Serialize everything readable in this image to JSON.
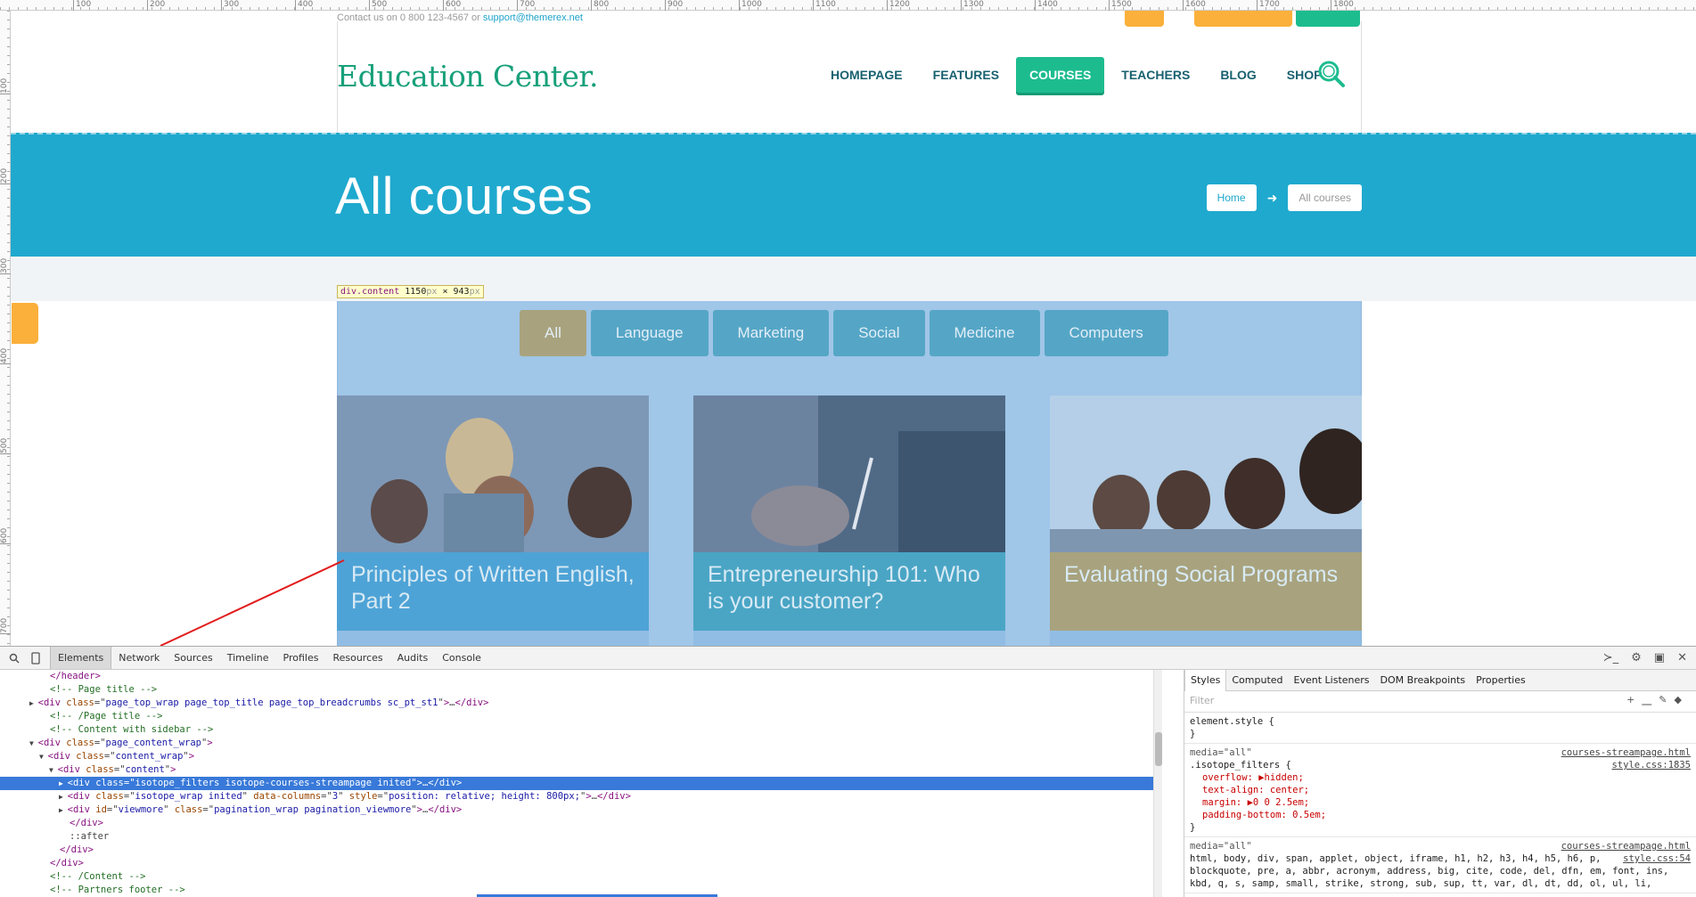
{
  "rulers": {
    "top": [
      "100",
      "200",
      "300",
      "400",
      "500",
      "600",
      "700",
      "800",
      "900",
      "1000",
      "1100",
      "1200",
      "1300",
      "1400",
      "1500",
      "1600",
      "1700",
      "1800"
    ],
    "left": [
      "100",
      "200",
      "300",
      "400",
      "500",
      "600",
      "700"
    ]
  },
  "page": {
    "contact_prefix": "Contact us on 0 800 123-4567 or",
    "contact_email": "support@themerex.net",
    "logo": "Education Center.",
    "nav": [
      "HOMEPAGE",
      "FEATURES",
      "COURSES",
      "TEACHERS",
      "BLOG",
      "SHOP"
    ],
    "nav_active": "COURSES",
    "title": "All courses",
    "breadcrumbs": {
      "home": "Home",
      "arrow": "➜",
      "current": "All courses"
    },
    "inspector_tip": {
      "tag": "div.content",
      "width": "1150",
      "height": "943",
      "unit": "px",
      "times": "×"
    },
    "filters": [
      "All",
      "Language",
      "Marketing",
      "Social",
      "Medicine",
      "Computers"
    ],
    "filters_active": "All",
    "cards": [
      {
        "title": "Principles of Written English, Part 2",
        "color": "#4ea3d6"
      },
      {
        "title": "Entrepreneurship 101: Who is your customer?",
        "color": "#4aa5c5"
      },
      {
        "title": "Evaluating Social Programs",
        "color": "#a8a37e"
      }
    ]
  },
  "devtools": {
    "tabs": [
      "Elements",
      "Network",
      "Sources",
      "Timeline",
      "Profiles",
      "Resources",
      "Audits",
      "Console"
    ],
    "active_tab": "Elements",
    "dom_lines": [
      {
        "indent": 4,
        "html": "<span class='tg'>&lt;/header&gt;</span>"
      },
      {
        "indent": 4,
        "html": "<span class='cm'>&lt;!-- Page title --&gt;</span>"
      },
      {
        "indent": 3,
        "arrow": "▶",
        "html": "<span class='tg'>&lt;div</span> <span class='an'>class</span>=\"<span class='av'>page_top_wrap page_top_title page_top_breadcrumbs sc_pt_st1</span>\"<span class='tg'>&gt;</span>…<span class='tg'>&lt;/div&gt;</span>"
      },
      {
        "indent": 4,
        "html": "<span class='cm'>&lt;!-- /Page title --&gt;</span>"
      },
      {
        "indent": 4,
        "html": "<span class='cm'>&lt;!-- Content with sidebar --&gt;</span>"
      },
      {
        "indent": 3,
        "arrow": "▼",
        "html": "<span class='tg'>&lt;div</span> <span class='an'>class</span>=\"<span class='av'>page_content_wrap</span>\"<span class='tg'>&gt;</span>"
      },
      {
        "indent": 4,
        "arrow": "▼",
        "html": "<span class='tg'>&lt;div</span> <span class='an'>class</span>=\"<span class='av'>content_wrap</span>\"<span class='tg'>&gt;</span>"
      },
      {
        "indent": 5,
        "arrow": "▼",
        "html": "<span class='tg'>&lt;div</span> <span class='an'>class</span>=\"<span class='av'>content</span>\"<span class='tg'>&gt;</span>"
      },
      {
        "indent": 6,
        "arrow": "▶",
        "sel": true,
        "html": "<span class='tg'>&lt;div</span> <span class='an'>class</span>=\"<span class='av'>isotope_filters isotope-courses-streampage inited</span>\"<span class='tg'>&gt;</span>…<span class='tg'>&lt;/div&gt;</span>"
      },
      {
        "indent": 6,
        "arrow": "▶",
        "html": "<span class='tg'>&lt;div</span> <span class='an'>class</span>=\"<span class='av'>isotope_wrap inited</span>\" <span class='an'>data-columns</span>=\"<span class='av'>3</span>\" <span class='an'>style</span>=\"<span class='av'>position: relative; height: 800px;</span>\"<span class='tg'>&gt;</span>…<span class='tg'>&lt;/div&gt;</span>"
      },
      {
        "indent": 6,
        "arrow": "▶",
        "html": "<span class='tg'>&lt;div</span> <span class='an'>id</span>=\"<span class='av'>viewmore</span>\" <span class='an'>class</span>=\"<span class='av'>pagination_wrap pagination_viewmore</span>\"<span class='tg'>&gt;</span>…<span class='tg'>&lt;/div&gt;</span>"
      },
      {
        "indent": 6,
        "html": "<span class='tg'>&lt;/div&gt;</span>"
      },
      {
        "indent": 6,
        "html": "::after"
      },
      {
        "indent": 5,
        "html": "<span class='tg'>&lt;/div&gt;</span>"
      },
      {
        "indent": 4,
        "html": "<span class='tg'>&lt;/div&gt;</span>"
      },
      {
        "indent": 4,
        "html": "<span class='cm'>&lt;!-- /Content --&gt;</span>"
      },
      {
        "indent": 4,
        "html": "<span class='cm'>&lt;!-- Partners footer --&gt;</span>"
      }
    ],
    "styles_tabs": [
      "Styles",
      "Computed",
      "Event Listeners",
      "DOM Breakpoints",
      "Properties"
    ],
    "styles_filter_placeholder": "Filter",
    "rules": [
      {
        "selector": "element.style {",
        "lines": [],
        "close": "}"
      },
      {
        "media": "media=\"all\"",
        "source": "courses-streampage.html",
        "source2": "style.css:1835",
        "selector": ".isotope_filters {",
        "lines": [
          "overflow: ▶hidden;",
          "text-align: center;",
          "margin: ▶0 0 2.5em;",
          "padding-bottom: 0.5em;"
        ],
        "close": "}"
      },
      {
        "media": "media=\"all\"",
        "source": "courses-streampage.html",
        "source2": "style.css:54",
        "selector": "html, body, div, span, applet, object, iframe, h1, h2, h3, h4, h5, h6, p,",
        "lines": [],
        "extra": [
          "blockquote, pre, a, abbr, acronym, address, big, cite, code, del, dfn, em, font, ins,",
          "kbd, q, s, samp, small, strike, strong, sub, sup, tt, var, dl, dt, dd, ol, ul, li,"
        ]
      }
    ]
  }
}
